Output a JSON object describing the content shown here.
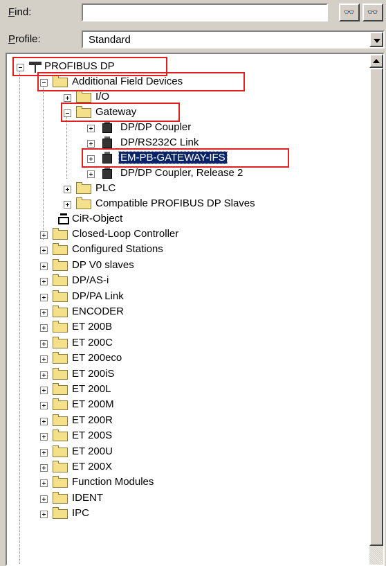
{
  "find": {
    "label": "Find:",
    "mnemonic": "F",
    "rest": "ind:",
    "value": "",
    "search_up": "â",
    "search_down": "â"
  },
  "profile": {
    "label": "Profile:",
    "mnemonic": "P",
    "rest": "rofile:",
    "value": "Standard"
  },
  "tree": {
    "root": "PROFIBUS DP",
    "additional": "Additional Field Devices",
    "io": "I/O",
    "gateway": "Gateway",
    "gateway_children": [
      "DP/DP Coupler",
      "DP/RS232C Link",
      "EM-PB-GATEWAY-IFS",
      "DP/DP Coupler, Release 2"
    ],
    "plc": "PLC",
    "compatible": "Compatible PROFIBUS DP Slaves",
    "cir": "CiR-Object",
    "folders": [
      "Closed-Loop Controller",
      "Configured Stations",
      "DP V0 slaves",
      "DP/AS-i",
      "DP/PA Link",
      "ENCODER",
      "ET 200B",
      "ET 200C",
      "ET 200eco",
      "ET 200iS",
      "ET 200L",
      "ET 200M",
      "ET 200R",
      "ET 200S",
      "ET 200U",
      "ET 200X",
      "Function Modules",
      "IDENT",
      "IPC"
    ]
  },
  "highlight_color": "#e02020",
  "selection_color": "#0a246a"
}
